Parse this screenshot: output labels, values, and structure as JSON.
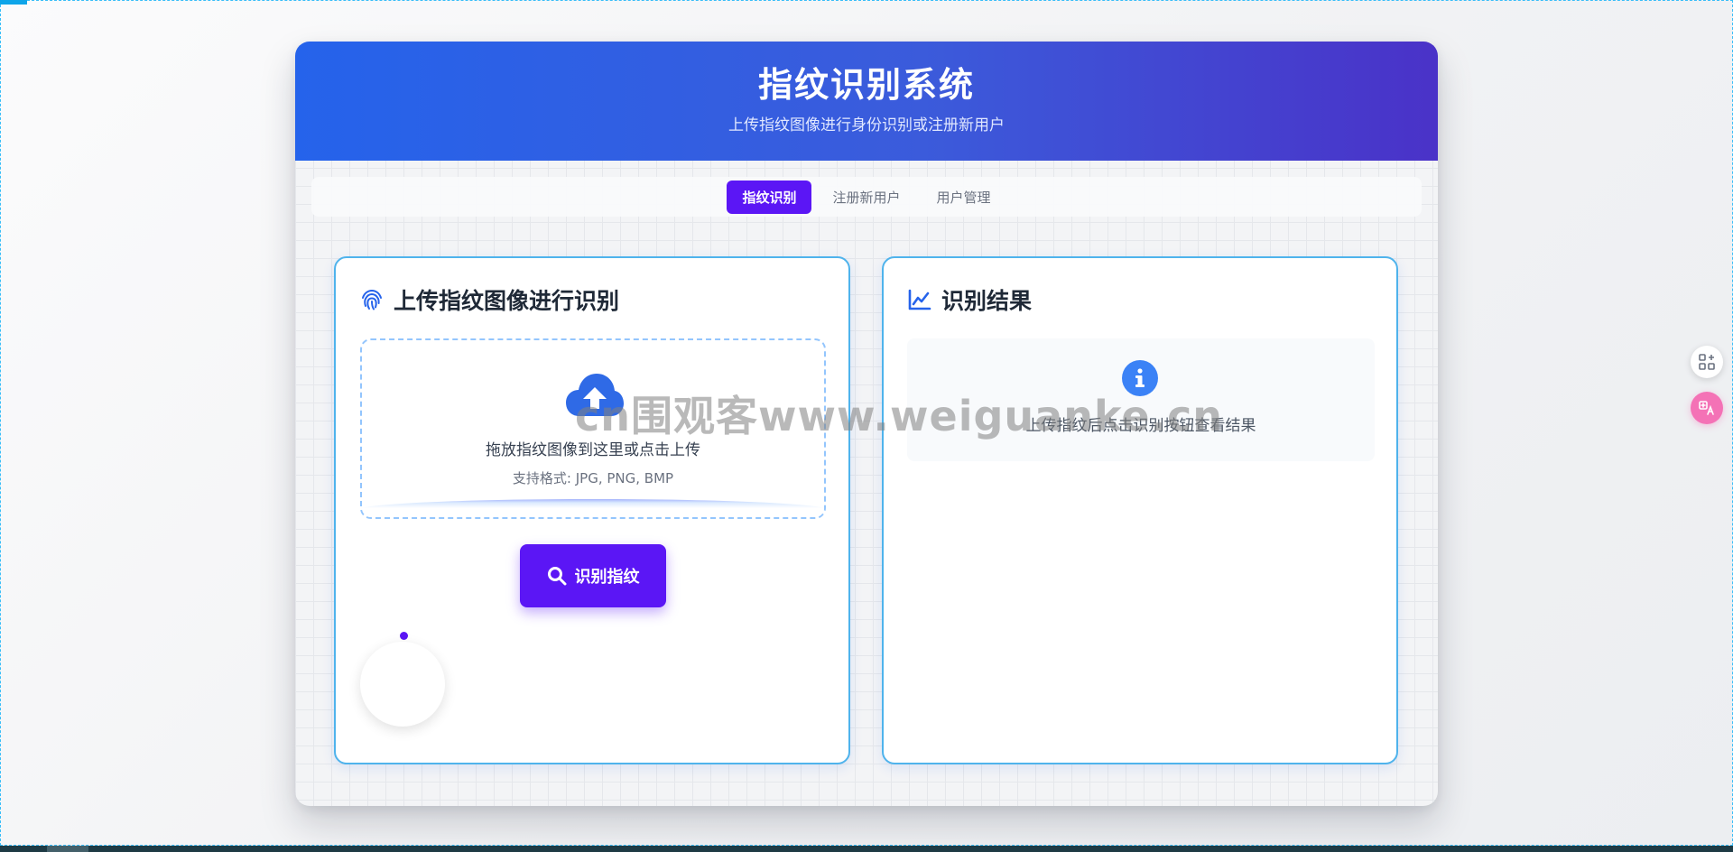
{
  "app": {
    "title": "指纹识别系统",
    "subtitle": "上传指纹图像进行身份识别或注册新用户"
  },
  "tabs": [
    {
      "label": "指纹识别",
      "active": true
    },
    {
      "label": "注册新用户",
      "active": false
    },
    {
      "label": "用户管理",
      "active": false
    }
  ],
  "upload_card": {
    "title": "上传指纹图像进行识别",
    "title_icon": "fingerprint-icon",
    "dropzone_text": "拖放指纹图像到这里或点击上传",
    "dropzone_hint": "支持格式: JPG, PNG, BMP",
    "dropzone_icon": "cloud-upload-icon",
    "identify_button": "识别指纹",
    "identify_icon": "search-icon"
  },
  "result_card": {
    "title": "识别结果",
    "title_icon": "line-chart-icon",
    "placeholder_icon": "info-icon",
    "placeholder_text": "上传指纹后点击识别按钮查看结果"
  },
  "watermark": "cn围观客www.weiguanke.cn",
  "colors": {
    "header_start": "#2563eb",
    "header_end": "#4a32c8",
    "accent": "#5b16f5",
    "card_border": "#4fb3ec",
    "info_blue": "#3b82f6"
  },
  "side_tools": [
    "apps-grid-icon",
    "translate-icon"
  ]
}
